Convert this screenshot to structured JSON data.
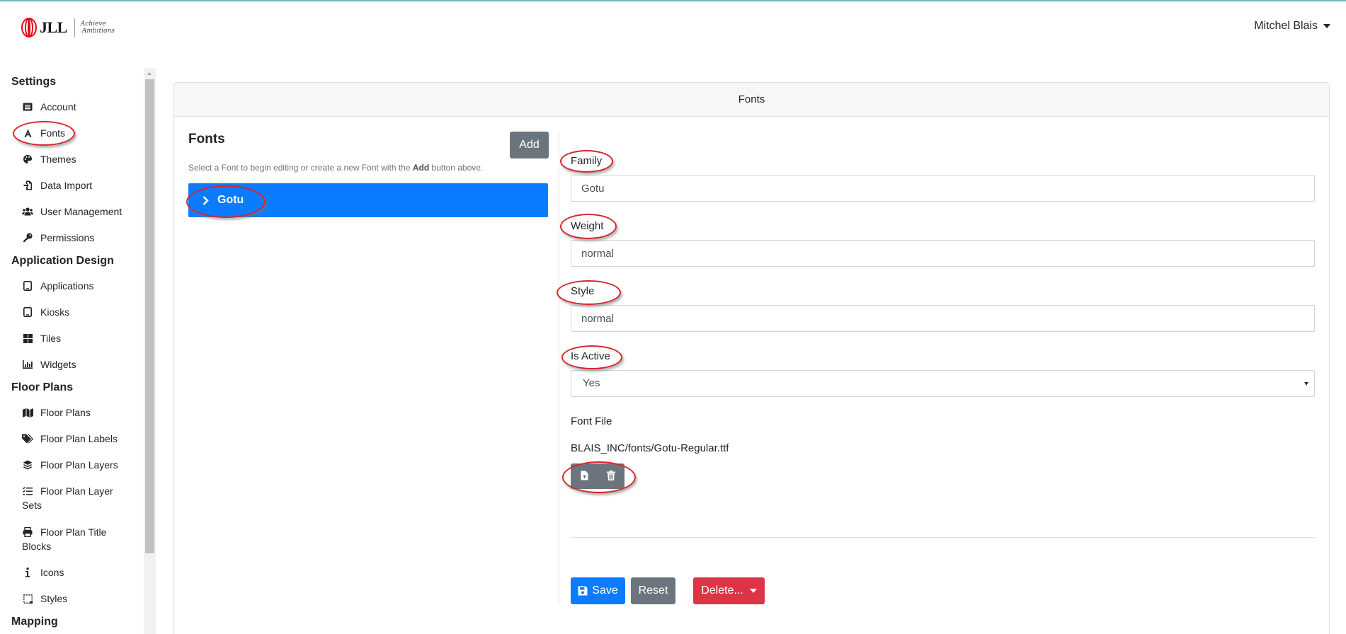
{
  "header": {
    "logo_text": "JLL",
    "logo_tagline_1": "Achieve",
    "logo_tagline_2": "Ambitions",
    "user_name": "Mitchel Blais"
  },
  "sidebar": {
    "sections": [
      {
        "title": "Settings",
        "items": [
          {
            "label": "Account",
            "icon": "id-card-icon"
          },
          {
            "label": "Fonts",
            "icon": "font-icon"
          },
          {
            "label": "Themes",
            "icon": "palette-icon"
          },
          {
            "label": "Data Import",
            "icon": "file-import-icon"
          },
          {
            "label": "User Management",
            "icon": "users-icon"
          },
          {
            "label": "Permissions",
            "icon": "key-icon"
          }
        ]
      },
      {
        "title": "Application Design",
        "items": [
          {
            "label": "Applications",
            "icon": "tablet-icon"
          },
          {
            "label": "Kiosks",
            "icon": "tablet-icon"
          },
          {
            "label": "Tiles",
            "icon": "grid-icon"
          },
          {
            "label": "Widgets",
            "icon": "chart-icon"
          }
        ]
      },
      {
        "title": "Floor Plans",
        "items": [
          {
            "label": "Floor Plans",
            "icon": "map-icon"
          },
          {
            "label": "Floor Plan Labels",
            "icon": "tags-icon"
          },
          {
            "label": "Floor Plan Layers",
            "icon": "layers-icon"
          },
          {
            "label": "Floor Plan Layer Sets",
            "icon": "tasks-icon"
          },
          {
            "label": "Floor Plan Title Blocks",
            "icon": "print-icon"
          },
          {
            "label": "Icons",
            "icon": "info-icon"
          },
          {
            "label": "Styles",
            "icon": "styles-icon"
          }
        ]
      },
      {
        "title": "Mapping",
        "items": []
      }
    ]
  },
  "card": {
    "header_title": "Fonts"
  },
  "list": {
    "title": "Fonts",
    "add_label": "Add",
    "hint_before": "Select a Font to begin editing or create a new Font with the ",
    "hint_bold": "Add",
    "hint_after": " button above.",
    "items": [
      {
        "label": "Gotu",
        "selected": true
      }
    ]
  },
  "form": {
    "family_label": "Family",
    "family_value": "Gotu",
    "weight_label": "Weight",
    "weight_value": "normal",
    "style_label": "Style",
    "style_value": "normal",
    "active_label": "Is Active",
    "active_value": "Yes",
    "file_label": "Font File",
    "file_path": "BLAIS_INC/fonts/Gotu-Regular.ttf"
  },
  "actions": {
    "save_label": "Save",
    "reset_label": "Reset",
    "delete_label": "Delete..."
  },
  "colors": {
    "primary": "#0b7cff",
    "secondary": "#6c757d",
    "danger": "#dc3545",
    "annotation": "#d8242a"
  }
}
